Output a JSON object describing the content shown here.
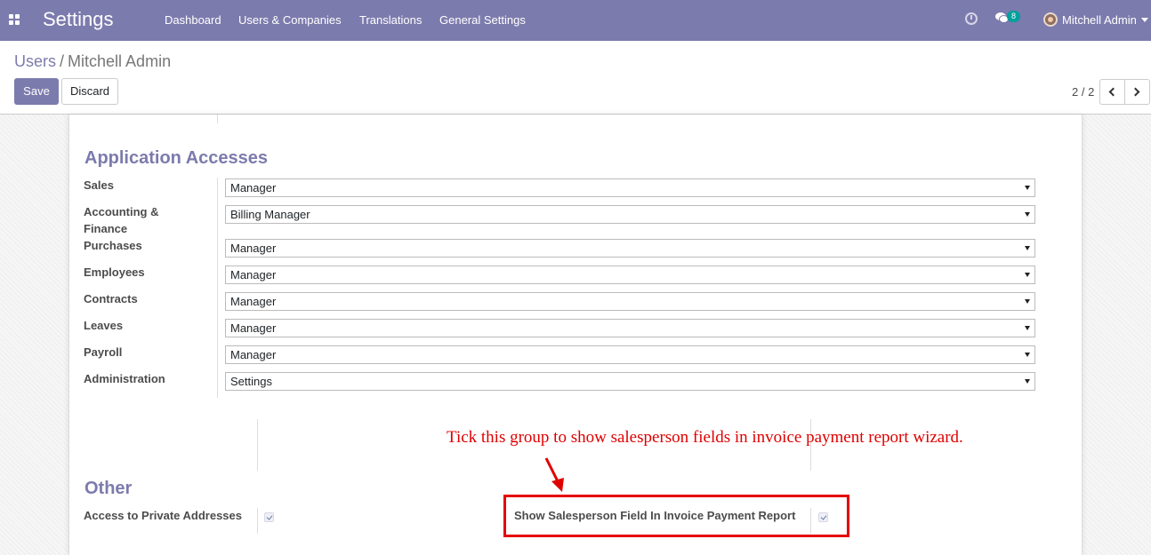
{
  "navbar": {
    "app_title": "Settings",
    "menu": [
      "Dashboard",
      "Users & Companies",
      "Translations",
      "General Settings"
    ],
    "messages_count": "8",
    "user_name": "Mitchell Admin",
    "icons": [
      "apps-icon",
      "clock-icon",
      "chat-icon",
      "avatar",
      "caret-down-icon"
    ]
  },
  "breadcrumb": {
    "parent": "Users",
    "separator": "/",
    "current": "Mitchell Admin"
  },
  "buttons": {
    "save": "Save",
    "discard": "Discard"
  },
  "pager": {
    "value": "2 / 2"
  },
  "application_accesses": {
    "title": "Application Accesses",
    "fields": [
      {
        "label": "Sales",
        "value": "Manager"
      },
      {
        "label": "Accounting & Finance",
        "value": "Billing Manager"
      },
      {
        "label": "Purchases",
        "value": "Manager"
      },
      {
        "label": "Employees",
        "value": "Manager"
      },
      {
        "label": "Contracts",
        "value": "Manager"
      },
      {
        "label": "Leaves",
        "value": "Manager"
      },
      {
        "label": "Payroll",
        "value": "Manager"
      },
      {
        "label": "Administration",
        "value": "Settings"
      }
    ]
  },
  "other": {
    "title": "Other",
    "private_addresses": {
      "label": "Access to Private Addresses",
      "checked": true
    },
    "show_salesperson": {
      "label": "Show Salesperson Field In Invoice Payment Report",
      "checked": true
    }
  },
  "annotation": {
    "text": "Tick this group to show salesperson fields in invoice payment report wizard.",
    "color": "#e00000"
  },
  "colors": {
    "brand": "#7c7bad",
    "badge": "#00a09d",
    "highlight": "#e60000"
  }
}
